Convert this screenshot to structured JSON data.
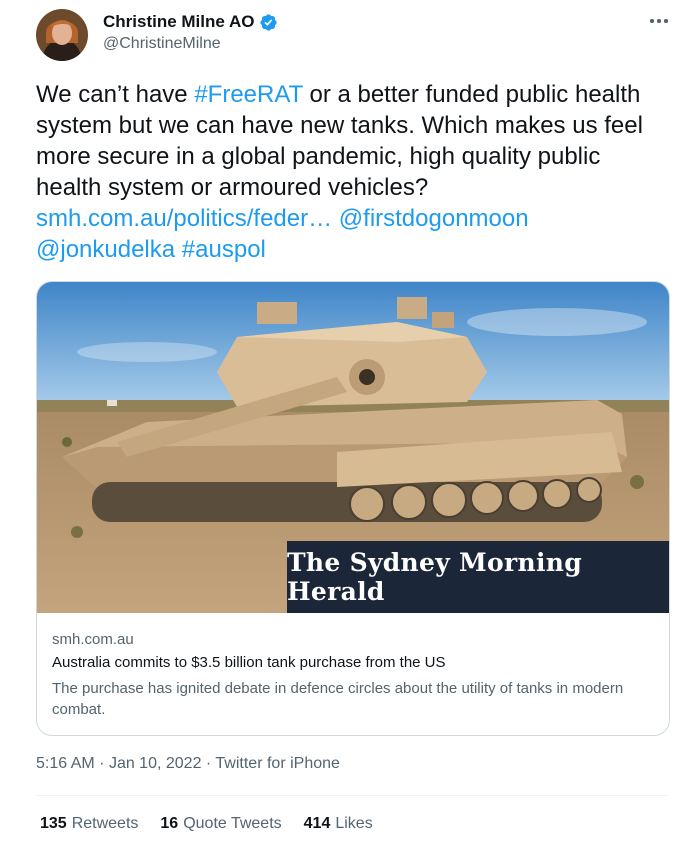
{
  "author": {
    "name": "Christine Milne AO",
    "handle": "@ChristineMilne",
    "verified": true
  },
  "tweet": {
    "text_1": "We can’t have ",
    "hashtag_freerat": "#FreeRAT",
    "text_2": " or a better funded public health system but we can have new tanks. Which makes us feel more secure in a global pandemic, high quality public health system or armoured vehicles?",
    "link": "smh.com.au/politics/feder…",
    "mention_1": "@firstdogonmoon",
    "mention_2": "@jonkudelka",
    "hashtag_auspol": "#auspol"
  },
  "card": {
    "masthead": "The Sydney Morning Herald",
    "domain": "smh.com.au",
    "title": "Australia commits to $3.5 billion tank purchase from the US",
    "description": "The purchase has ignited debate in defence circles about the utility of tanks in modern combat."
  },
  "meta": {
    "time": "5:16 AM",
    "date": "Jan 10, 2022",
    "separator": "·",
    "source": "Twitter for iPhone"
  },
  "stats": {
    "retweets_count": "135",
    "retweets_label": "Retweets",
    "quotes_count": "16",
    "quotes_label": "Quote Tweets",
    "likes_count": "414",
    "likes_label": "Likes"
  },
  "colors": {
    "link": "#1d9bf0",
    "text": "#0f1419",
    "secondary": "#536471",
    "masthead_bg": "#1b2639"
  },
  "icons": [
    "verified-badge-icon",
    "more-options-icon"
  ]
}
